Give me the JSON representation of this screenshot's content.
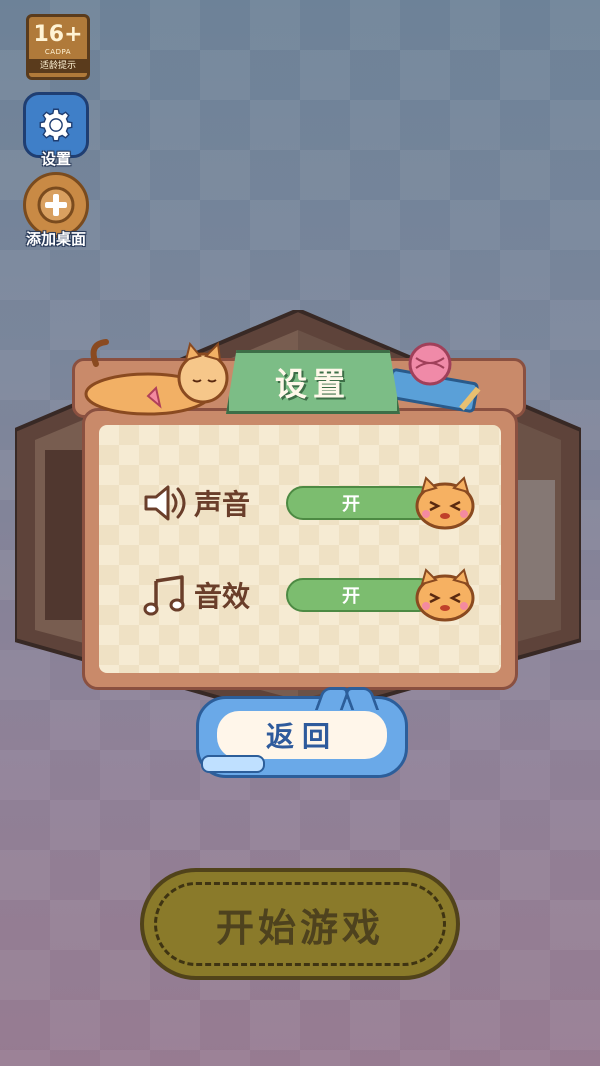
{
  "age_rating": {
    "value": "16+",
    "tag": "CADPA",
    "note": "适龄提示"
  },
  "side_buttons": {
    "settings": {
      "label": "设置",
      "icon": "gear-icon"
    },
    "add_desktop": {
      "label": "添加桌面",
      "icon": "plus-icon"
    }
  },
  "settings_panel": {
    "title": "设置",
    "rows": [
      {
        "label": "声音",
        "icon": "speaker-icon",
        "state": "开"
      },
      {
        "label": "音效",
        "icon": "music-note-icon",
        "state": "开"
      }
    ],
    "back_label": "返回"
  },
  "start_button": {
    "label": "开始游戏"
  },
  "colors": {
    "panel_border": "#8a5040",
    "panel_fill": "#c98a6a",
    "title_plate": "#7cbd86",
    "toggle_on": "#7cbd6f",
    "back_button": "#6aa9e8",
    "start_button": "#8a7a2a"
  }
}
